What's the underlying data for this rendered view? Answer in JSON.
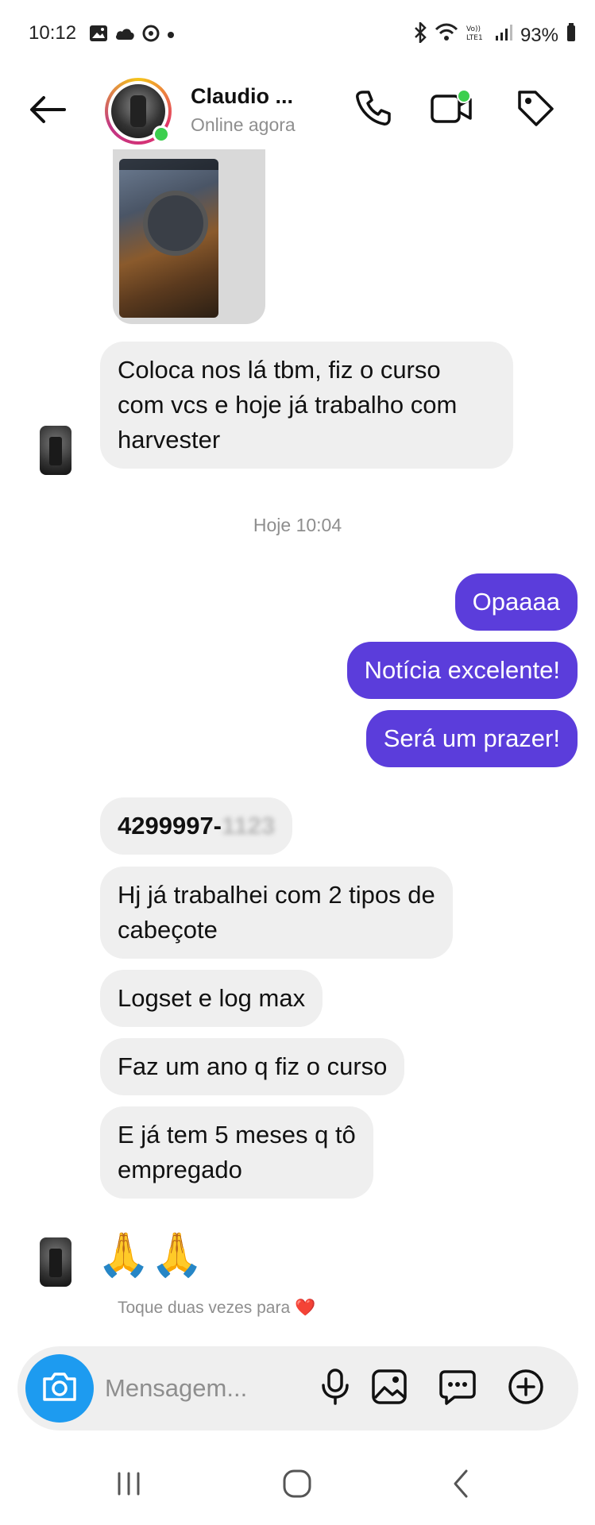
{
  "status_bar": {
    "time": "10:12",
    "battery": "93%"
  },
  "header": {
    "contact_name": "Claudio ...",
    "contact_status": "Online agora",
    "online_color": "#3ccf4e"
  },
  "messages": {
    "incoming_1": [
      "Coloca nos lá tbm, fiz o curso",
      "com vcs e hoje já trabalho com",
      "harvester"
    ],
    "timestamp": "Hoje 10:04",
    "outgoing": [
      "Opaaaa",
      "Notícia excelente!",
      "Será um prazer!"
    ],
    "incoming_2": {
      "phone_prefix": "4299997-",
      "phone_redacted": "1123",
      "msg_a": [
        "Hj já trabalhei com 2 tipos de",
        "cabeçote"
      ],
      "msg_b": "Logset e log max",
      "msg_c": "Faz um ano q fiz o curso",
      "msg_d": [
        "E já tem 5 meses q tô",
        "empregado"
      ],
      "emoji": "🙏🙏"
    },
    "double_tap_hint": "Toque duas vezes para",
    "heart": "❤️"
  },
  "composer": {
    "placeholder": "Mensagem..."
  },
  "colors": {
    "outgoing_bubble": "#5b3ddb",
    "incoming_bubble": "#efefef",
    "camera_button": "#1d9bf0"
  }
}
